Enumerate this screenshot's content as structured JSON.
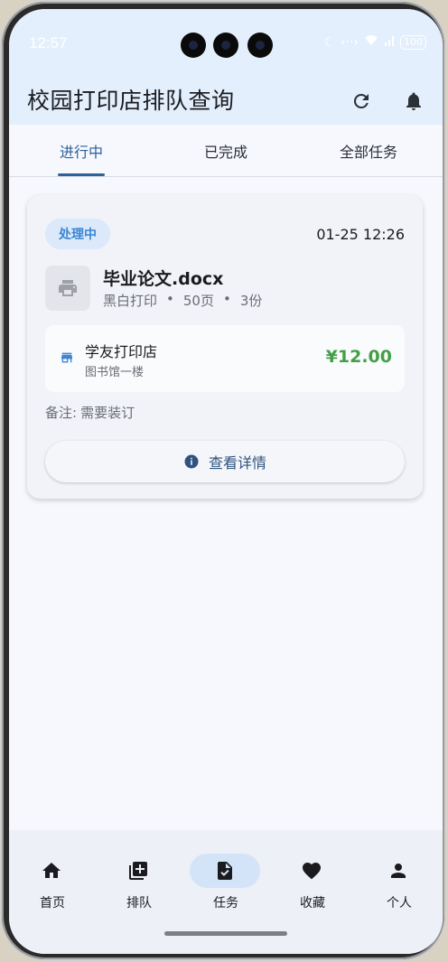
{
  "status_bar": {
    "time": "12:57",
    "battery": "100"
  },
  "app_bar": {
    "title": "校园打印店排队查询"
  },
  "tabs": [
    {
      "label": "进行中",
      "active": true
    },
    {
      "label": "已完成",
      "active": false
    },
    {
      "label": "全部任务",
      "active": false
    }
  ],
  "task": {
    "status": "处理中",
    "timestamp": "01-25 12:26",
    "file_name": "毕业论文.docx",
    "print_mode": "黑白打印",
    "pages": "50页",
    "copies": "3份",
    "separator": "•",
    "shop_name": "学友打印店",
    "shop_location": "图书馆一楼",
    "price": "¥12.00",
    "note_label": "备注:",
    "note_text": "需要装订",
    "details_button": "查看详情"
  },
  "bottom_nav": [
    {
      "label": "首页",
      "icon": "home-icon"
    },
    {
      "label": "排队",
      "icon": "add-queue-icon"
    },
    {
      "label": "任务",
      "icon": "task-icon",
      "active": true
    },
    {
      "label": "收藏",
      "icon": "heart-icon"
    },
    {
      "label": "个人",
      "icon": "person-icon"
    }
  ],
  "colors": {
    "accent": "#2f6199",
    "header_bg": "#e3effc",
    "badge_text": "#3a86d4",
    "price": "#43a047"
  }
}
